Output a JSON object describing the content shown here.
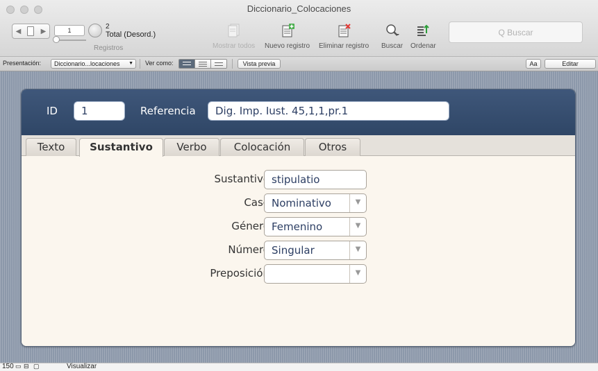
{
  "window": {
    "title": "Diccionario_Colocaciones"
  },
  "toolbar": {
    "record_input_value": "1",
    "record_count": "2",
    "record_total": "Total (Desord.)",
    "records_label": "Registros",
    "show_all_label": "Mostrar todos",
    "new_record_label": "Nuevo registro",
    "delete_record_label": "Eliminar registro",
    "find_label": "Buscar",
    "sort_label": "Ordenar",
    "search_placeholder": "Q Buscar"
  },
  "layoutbar": {
    "layout_label": "Presentación:",
    "layout_value": "Diccionario...locaciones",
    "view_as_label": "Ver como:",
    "preview_label": "Vista previa",
    "font_btn_label": "Aa",
    "edit_label": "Editar"
  },
  "form": {
    "id_label": "ID",
    "id_value": "1",
    "ref_label": "Referencia",
    "ref_value": "Dig. Imp. Iust. 45,1,1,pr.1",
    "tabs": [
      {
        "label": "Texto",
        "active": false
      },
      {
        "label": "Sustantivo",
        "active": true
      },
      {
        "label": "Verbo",
        "active": false
      },
      {
        "label": "Colocación",
        "active": false
      },
      {
        "label": "Otros",
        "active": false
      }
    ],
    "fields": [
      {
        "label": "Sustantivo",
        "value": "stipulatio",
        "dropdown": false
      },
      {
        "label": "Caso",
        "value": "Nominativo",
        "dropdown": true
      },
      {
        "label": "Género",
        "value": "Femenino",
        "dropdown": true
      },
      {
        "label": "Número",
        "value": "Singular",
        "dropdown": true
      },
      {
        "label": "Preposición",
        "value": "",
        "dropdown": true
      }
    ]
  },
  "statusbar": {
    "zoom": "150",
    "mode_label": "Visualizar"
  }
}
